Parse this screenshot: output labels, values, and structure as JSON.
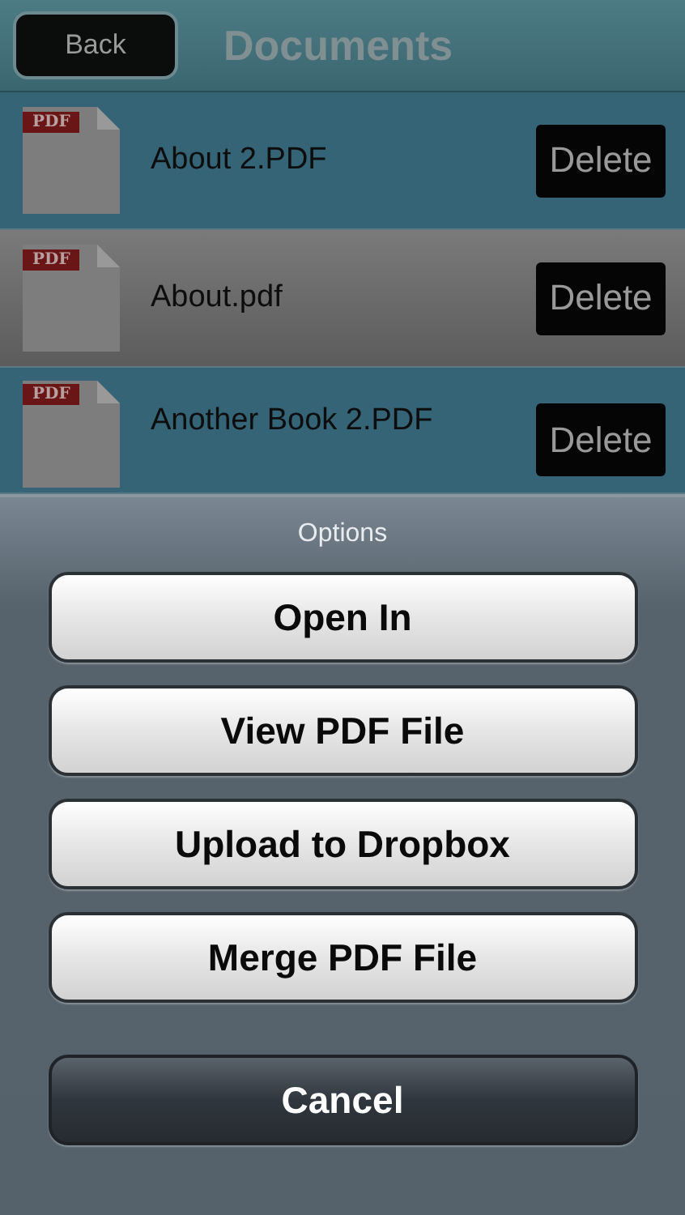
{
  "nav_bar": {
    "back_button": "Back",
    "title": "Documents"
  },
  "documents": [
    {
      "name": "About 2.PDF",
      "badge": "PDF",
      "action": "Delete",
      "selected": false
    },
    {
      "name": "About.pdf",
      "badge": "PDF",
      "action": "Delete",
      "selected": true
    },
    {
      "name": "Another Book 2.PDF",
      "badge": "PDF",
      "action": "Delete",
      "selected": false
    }
  ],
  "action_sheet": {
    "title": "Options",
    "options": [
      {
        "label": "Open In",
        "kind": "default"
      },
      {
        "label": "View PDF File",
        "kind": "default"
      },
      {
        "label": "Upload to Dropbox",
        "kind": "default"
      },
      {
        "label": "Merge PDF File",
        "kind": "default"
      },
      {
        "label": "Cancel",
        "kind": "cancel"
      }
    ]
  }
}
